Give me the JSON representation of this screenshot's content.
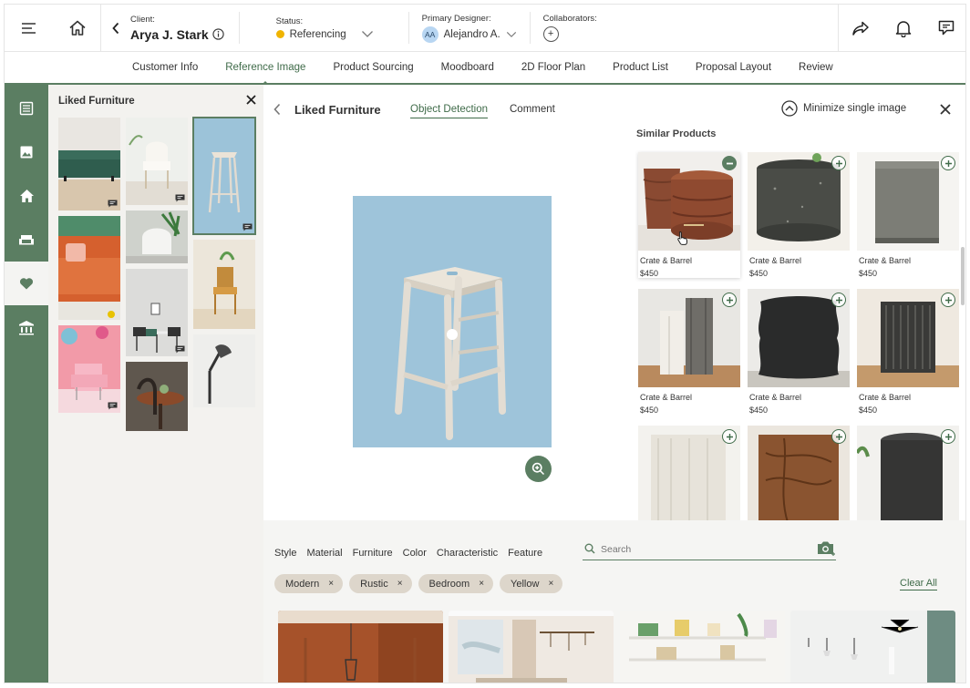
{
  "header": {
    "client_label": "Client:",
    "client_name": "Arya J. Stark",
    "status_label": "Status:",
    "status_value": "Referencing",
    "status_color": "#f0b400",
    "designer_label": "Primary Designer:",
    "designer_initials": "AA",
    "designer_name": "Alejandro A.",
    "collaborators_label": "Collaborators:",
    "collaborators_add": "+"
  },
  "tabs": [
    {
      "label": "Customer Info"
    },
    {
      "label": "Reference Image",
      "active": true
    },
    {
      "label": "Product Sourcing"
    },
    {
      "label": "Moodboard"
    },
    {
      "label": "2D Floor Plan"
    },
    {
      "label": "Product List"
    },
    {
      "label": "Proposal Layout"
    },
    {
      "label": "Review"
    }
  ],
  "rail": [
    {
      "icon": "list-icon"
    },
    {
      "icon": "image-icon"
    },
    {
      "icon": "home-icon"
    },
    {
      "icon": "sofa-icon"
    },
    {
      "icon": "heart-icon",
      "active": true
    },
    {
      "icon": "bank-icon"
    }
  ],
  "liked_panel": {
    "title": "Liked Furniture"
  },
  "main": {
    "title": "Liked Furniture",
    "tab_detection": "Object Detection",
    "tab_comment": "Comment",
    "minimize_label": "Minimize single image",
    "similar_title": "Similar Products",
    "products": [
      {
        "brand": "Crate & Barrel",
        "price": "$450"
      },
      {
        "brand": "Crate & Barrel",
        "price": "$450"
      },
      {
        "brand": "Crate & Barrel",
        "price": "$450"
      },
      {
        "brand": "Crate & Barrel",
        "price": "$450"
      },
      {
        "brand": "Crate & Barrel",
        "price": "$450"
      },
      {
        "brand": "Crate & Barrel",
        "price": "$450"
      },
      {
        "brand": "",
        "price": ""
      },
      {
        "brand": "",
        "price": ""
      },
      {
        "brand": "",
        "price": ""
      }
    ]
  },
  "filters": {
    "categories": [
      "Style",
      "Material",
      "Furniture",
      "Color",
      "Characteristic",
      "Feature"
    ],
    "search_placeholder": "Search",
    "chips": [
      {
        "label": "Modern",
        "remove": "×"
      },
      {
        "label": "Rustic",
        "remove": "×"
      },
      {
        "label": "Bedroom",
        "remove": "×"
      },
      {
        "label": "Yellow",
        "remove": "×"
      }
    ],
    "clear_all": "Clear All"
  },
  "colors": {
    "accent": "#5b7e62",
    "accent_text": "#3f6b49",
    "chip_bg": "#ddd6cb"
  }
}
